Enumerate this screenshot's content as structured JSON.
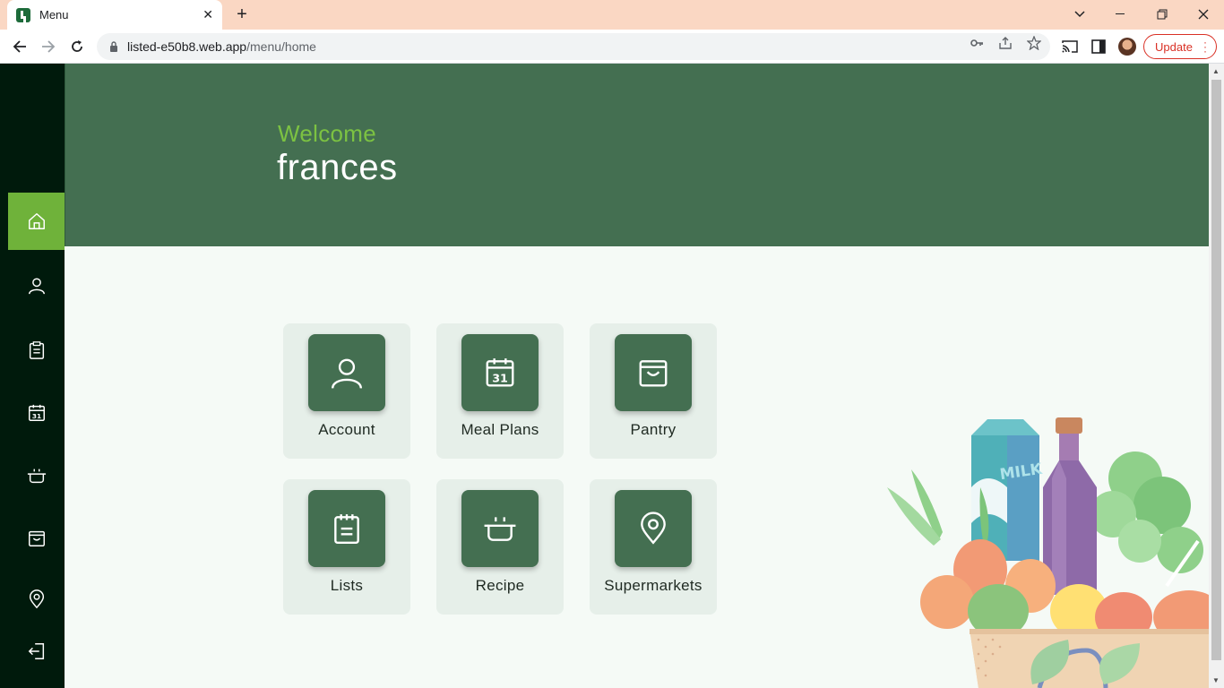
{
  "browser": {
    "tab_title": "Menu",
    "tab_close": "✕",
    "new_tab": "+",
    "url_host": "listed-e50b8.web.app",
    "url_path": "/menu/home",
    "update_label": "Update"
  },
  "hero": {
    "welcome": "Welcome",
    "username": "frances",
    "bg_color": "#446f51",
    "accent_color": "#7cc242"
  },
  "sidebar": {
    "items": [
      {
        "name": "home",
        "icon": "home-icon",
        "active": true
      },
      {
        "name": "account",
        "icon": "user-icon",
        "active": false
      },
      {
        "name": "lists",
        "icon": "clipboard-icon",
        "active": false
      },
      {
        "name": "meal-plans",
        "icon": "calendar-icon",
        "active": false
      },
      {
        "name": "recipe",
        "icon": "pot-icon",
        "active": false
      },
      {
        "name": "pantry",
        "icon": "box-icon",
        "active": false
      },
      {
        "name": "supermarkets",
        "icon": "map-pin-icon",
        "active": false
      },
      {
        "name": "logout",
        "icon": "logout-icon",
        "active": false
      }
    ],
    "bg_color": "#001a0c",
    "active_color": "#6fb23a"
  },
  "menu": {
    "cards": [
      {
        "label": "Account",
        "icon": "user-icon"
      },
      {
        "label": "Meal Plans",
        "icon": "calendar-icon"
      },
      {
        "label": "Pantry",
        "icon": "box-icon"
      },
      {
        "label": "Lists",
        "icon": "clipboard-icon"
      },
      {
        "label": "Recipe",
        "icon": "pot-icon"
      },
      {
        "label": "Supermarkets",
        "icon": "map-pin-icon"
      }
    ]
  },
  "illustration": {
    "milk_label": "MILK"
  }
}
